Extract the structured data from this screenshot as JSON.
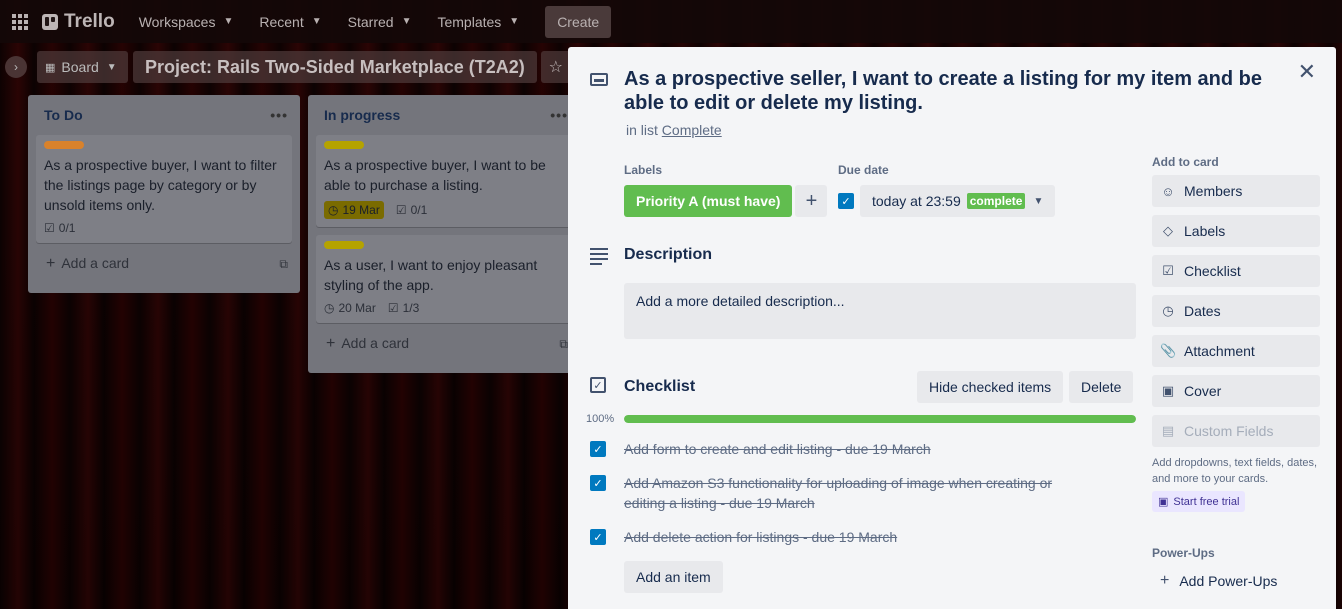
{
  "header": {
    "logo": "Trello",
    "nav": [
      "Workspaces",
      "Recent",
      "Starred",
      "Templates"
    ],
    "create": "Create"
  },
  "board": {
    "view_label": "Board",
    "title": "Project: Rails Two-Sided Marketplace (T2A2)"
  },
  "lists": {
    "todo": {
      "title": "To Do",
      "card": {
        "label_color": "#d9822b",
        "text": "As a prospective buyer, I want to filter the listings page by category or by unsold items only.",
        "checklist": "0/1"
      },
      "add_card": "Add a card"
    },
    "progress": {
      "title": "In progress",
      "card1": {
        "label_color": "#b5a300",
        "text": "As a prospective buyer, I want to be able to purchase a listing.",
        "due": "19 Mar",
        "checklist": "0/1"
      },
      "card2": {
        "label_color": "#b5a300",
        "text": "As a user, I want to enjoy pleasant styling of the app.",
        "due": "20 Mar",
        "checklist": "1/3"
      },
      "add_card": "Add a card"
    }
  },
  "modal": {
    "title": "As a prospective seller, I want to create a listing for my item and be able to edit or delete my listing.",
    "in_list_prefix": "in list",
    "in_list_name": "Complete",
    "labels_heading": "Labels",
    "label_chip": "Priority A (must have)",
    "label_color": "#61bd4f",
    "due_heading": "Due date",
    "due_value": "today at 23:59",
    "due_status": "complete",
    "description_heading": "Description",
    "description_placeholder": "Add a more detailed description...",
    "checklist_heading": "Checklist",
    "hide_checked": "Hide checked items",
    "delete": "Delete",
    "progress_percent": "100%",
    "progress_fraction": 1.0,
    "items": [
      "Add form to create and edit listing - due 19 March",
      "Add Amazon S3 functionality for uploading of image when creating or editing a listing - due 19 March",
      "Add delete action for listings - due 19 March"
    ],
    "add_item": "Add an item"
  },
  "sidebar": {
    "heading": "Add to card",
    "buttons": [
      "Members",
      "Labels",
      "Checklist",
      "Dates",
      "Attachment",
      "Cover",
      "Custom Fields"
    ],
    "note": "Add dropdowns, text fields, dates, and more to your cards.",
    "trial": "Start free trial",
    "powerups_heading": "Power-Ups",
    "add_powerups": "Add Power-Ups"
  }
}
